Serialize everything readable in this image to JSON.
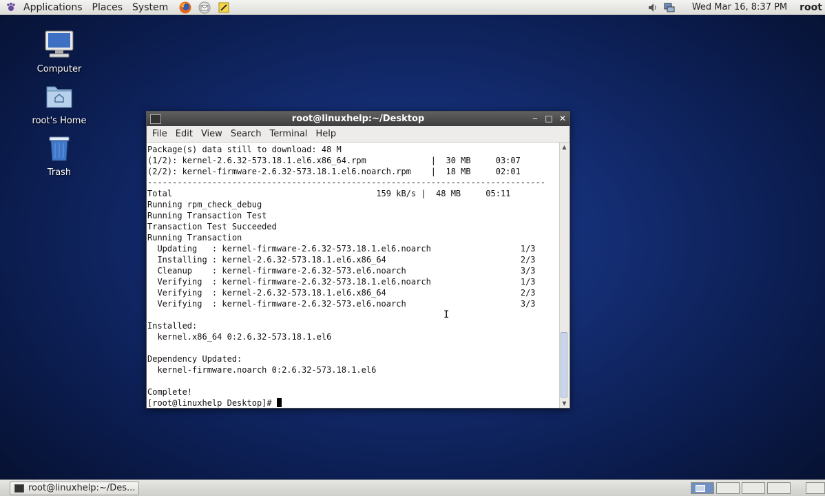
{
  "top_panel": {
    "menus": [
      "Applications",
      "Places",
      "System"
    ],
    "clock": "Wed Mar 16,  8:37 PM",
    "user": "root"
  },
  "desktop_icons": [
    {
      "label": "Computer"
    },
    {
      "label": "root's Home"
    },
    {
      "label": "Trash"
    }
  ],
  "terminal": {
    "title": "root@linuxhelp:~/Desktop",
    "menus": [
      "File",
      "Edit",
      "View",
      "Search",
      "Terminal",
      "Help"
    ],
    "lines": [
      "Package(s) data still to download: 48 M",
      "(1/2): kernel-2.6.32-573.18.1.el6.x86_64.rpm             |  30 MB     03:07",
      "(2/2): kernel-firmware-2.6.32-573.18.1.el6.noarch.rpm    |  18 MB     02:01",
      "--------------------------------------------------------------------------------",
      "Total                                         159 kB/s |  48 MB     05:11",
      "Running rpm_check_debug",
      "Running Transaction Test",
      "Transaction Test Succeeded",
      "Running Transaction",
      "  Updating   : kernel-firmware-2.6.32-573.18.1.el6.noarch                  1/3",
      "  Installing : kernel-2.6.32-573.18.1.el6.x86_64                           2/3",
      "  Cleanup    : kernel-firmware-2.6.32-573.el6.noarch                       3/3",
      "  Verifying  : kernel-firmware-2.6.32-573.18.1.el6.noarch                  1/3",
      "  Verifying  : kernel-2.6.32-573.18.1.el6.x86_64                           2/3",
      "  Verifying  : kernel-firmware-2.6.32-573.el6.noarch                       3/3",
      "",
      "Installed:",
      "  kernel.x86_64 0:2.6.32-573.18.1.el6",
      "",
      "Dependency Updated:",
      "  kernel-firmware.noarch 0:2.6.32-573.18.1.el6",
      "",
      "Complete!"
    ],
    "prompt": "[root@linuxhelp Desktop]# "
  },
  "taskbar": {
    "task_label": "root@linuxhelp:~/Des..."
  }
}
